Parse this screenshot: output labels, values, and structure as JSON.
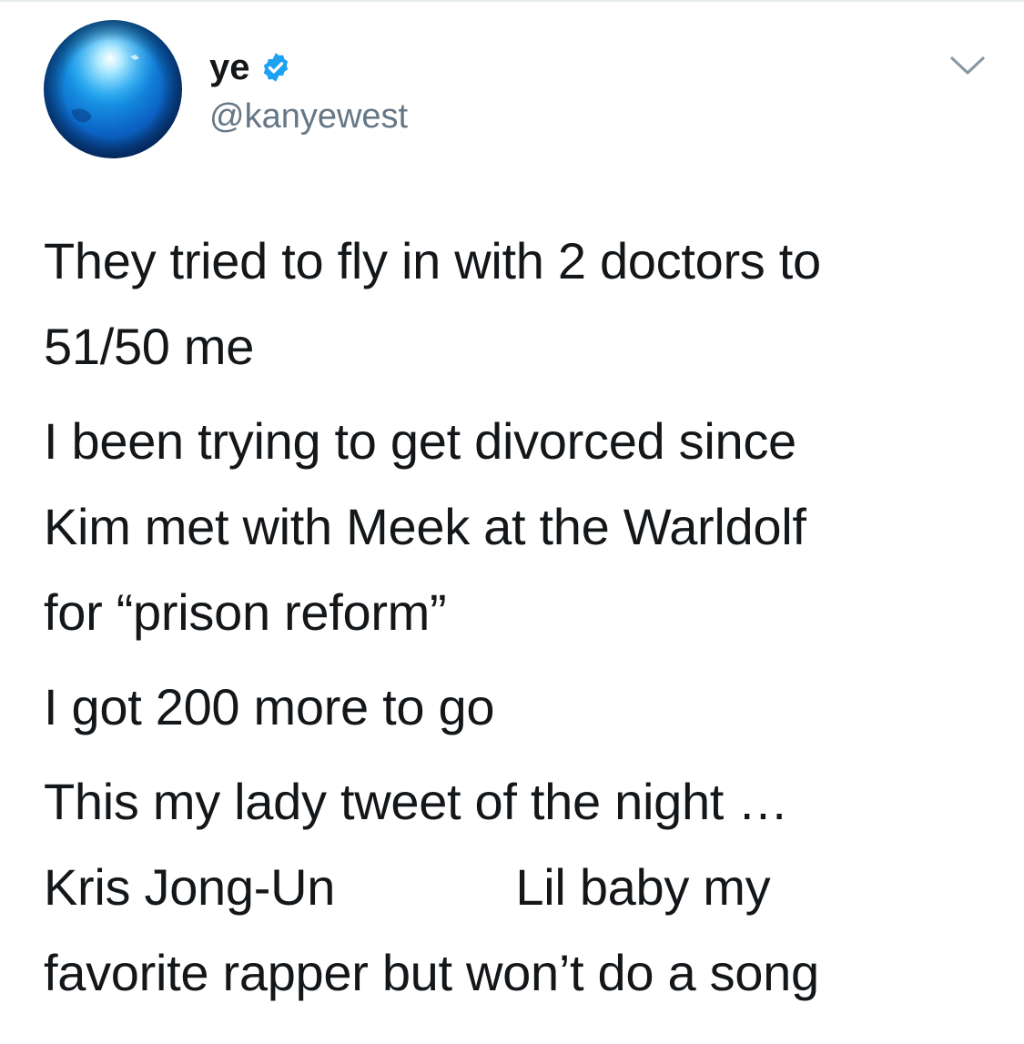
{
  "tweet": {
    "author": {
      "display_name": "ye",
      "handle": "@kanyewest",
      "verified_icon": "verified-badge-icon",
      "avatar_icon": "blue-globe-avatar"
    },
    "menu_icon": "chevron-down-icon",
    "accent_color": "#1da1f2",
    "text_color": "#14171a",
    "secondary_text_color": "#657786",
    "paragraphs": [
      "They tried to fly in with 2 doctors to\n51/50 me",
      "I been trying to get divorced since\nKim met with Meek at the Warldolf\nfor “prison reform”",
      "I got 200 more to go",
      "This my lady tweet of the night …\nKris Jong-Un             Lil baby my\nfavorite rapper but won’t do a song"
    ]
  }
}
